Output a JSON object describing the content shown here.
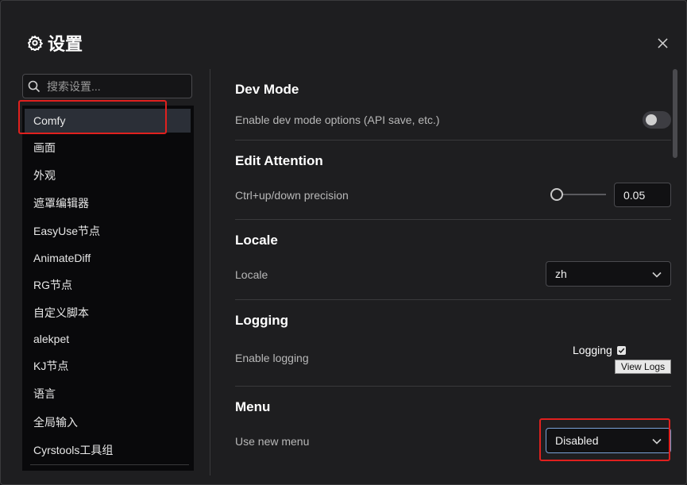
{
  "dialog": {
    "title": "设置",
    "close_icon": "close-icon"
  },
  "search": {
    "placeholder": "搜索设置..."
  },
  "sidebar": {
    "items": [
      {
        "label": "Comfy",
        "active": true
      },
      {
        "label": "画面"
      },
      {
        "label": "外观"
      },
      {
        "label": "遮罩编辑器"
      },
      {
        "label": "EasyUse节点"
      },
      {
        "label": "AnimateDiff"
      },
      {
        "label": "RG节点"
      },
      {
        "label": "自定义脚本"
      },
      {
        "label": "alekpet"
      },
      {
        "label": "KJ节点"
      },
      {
        "label": "语言"
      },
      {
        "label": "全局输入"
      },
      {
        "label": "Cyrstools工具组"
      }
    ]
  },
  "sections": {
    "dev_mode": {
      "title": "Dev Mode",
      "label": "Enable dev mode options (API save, etc.)",
      "enabled": false
    },
    "edit_attention": {
      "title": "Edit Attention",
      "label": "Ctrl+up/down precision",
      "value": "0.05",
      "slider_fraction": 0.0
    },
    "locale": {
      "title": "Locale",
      "label": "Locale",
      "value": "zh"
    },
    "logging": {
      "title": "Logging",
      "label": "Enable logging",
      "checkbox_label": "Logging",
      "checked": true,
      "view_logs": "View Logs"
    },
    "menu": {
      "title": "Menu",
      "label": "Use new menu",
      "value": "Disabled"
    }
  },
  "colors": {
    "highlight": "#e0201e",
    "focus_border": "#7aa2d8",
    "active_item": "#2b2f37"
  }
}
